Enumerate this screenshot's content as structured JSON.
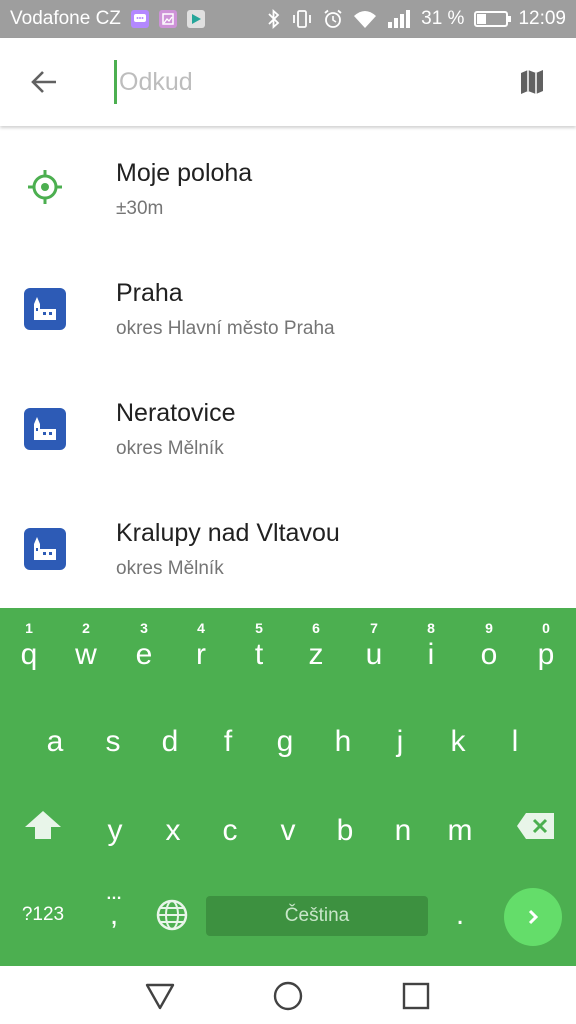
{
  "status_bar": {
    "carrier": "Vodafone CZ",
    "battery_text": "31 %",
    "battery_level": 0.31,
    "time": "12:09",
    "icons": [
      "messenger-icon",
      "gallery-icon",
      "play-store-icon",
      "bluetooth-icon",
      "vibrate-icon",
      "alarm-icon",
      "wifi-icon",
      "signal-icon",
      "battery-icon"
    ]
  },
  "search": {
    "placeholder": "Odkud",
    "value": "",
    "back_icon": "arrow-back-icon",
    "map_icon": "map-icon"
  },
  "results": [
    {
      "icon": "my-location-icon",
      "title": "Moje poloha",
      "subtitle": "±30m"
    },
    {
      "icon": "city-icon",
      "title": "Praha",
      "subtitle": "okres Hlavní město Praha"
    },
    {
      "icon": "city-icon",
      "title": "Neratovice",
      "subtitle": "okres Mělník"
    },
    {
      "icon": "city-icon",
      "title": "Kralupy nad Vltavou",
      "subtitle": "okres Mělník"
    }
  ],
  "keyboard": {
    "row1": [
      {
        "ch": "q",
        "hint": "1"
      },
      {
        "ch": "w",
        "hint": "2"
      },
      {
        "ch": "e",
        "hint": "3"
      },
      {
        "ch": "r",
        "hint": "4"
      },
      {
        "ch": "t",
        "hint": "5"
      },
      {
        "ch": "z",
        "hint": "6"
      },
      {
        "ch": "u",
        "hint": "7"
      },
      {
        "ch": "i",
        "hint": "8"
      },
      {
        "ch": "o",
        "hint": "9"
      },
      {
        "ch": "p",
        "hint": "0"
      }
    ],
    "row2": [
      "a",
      "s",
      "d",
      "f",
      "g",
      "h",
      "j",
      "k",
      "l"
    ],
    "row3": [
      "y",
      "x",
      "c",
      "v",
      "b",
      "n",
      "m"
    ],
    "symbols_label": "?123",
    "comma_label": ",",
    "comma_hint": "…",
    "space_label": "Čeština",
    "period_label": ".",
    "color": "#4caf50"
  },
  "nav_bar": {
    "icons": [
      "back-triangle-icon",
      "home-circle-icon",
      "recents-square-icon"
    ]
  }
}
